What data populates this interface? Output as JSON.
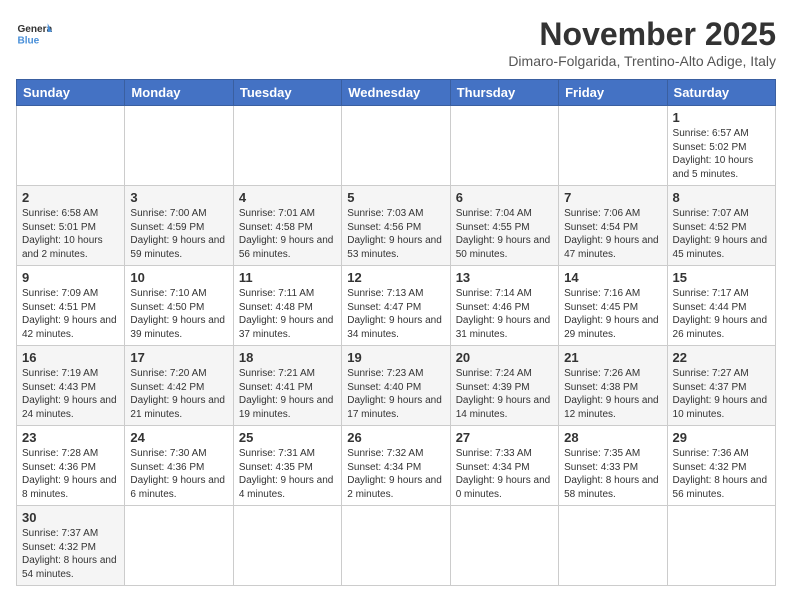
{
  "header": {
    "logo_general": "General",
    "logo_blue": "Blue",
    "month_title": "November 2025",
    "subtitle": "Dimaro-Folgarida, Trentino-Alto Adige, Italy"
  },
  "days_of_week": [
    "Sunday",
    "Monday",
    "Tuesday",
    "Wednesday",
    "Thursday",
    "Friday",
    "Saturday"
  ],
  "weeks": [
    [
      {
        "day": "",
        "info": ""
      },
      {
        "day": "",
        "info": ""
      },
      {
        "day": "",
        "info": ""
      },
      {
        "day": "",
        "info": ""
      },
      {
        "day": "",
        "info": ""
      },
      {
        "day": "",
        "info": ""
      },
      {
        "day": "1",
        "info": "Sunrise: 6:57 AM\nSunset: 5:02 PM\nDaylight: 10 hours and 5 minutes."
      }
    ],
    [
      {
        "day": "2",
        "info": "Sunrise: 6:58 AM\nSunset: 5:01 PM\nDaylight: 10 hours and 2 minutes."
      },
      {
        "day": "3",
        "info": "Sunrise: 7:00 AM\nSunset: 4:59 PM\nDaylight: 9 hours and 59 minutes."
      },
      {
        "day": "4",
        "info": "Sunrise: 7:01 AM\nSunset: 4:58 PM\nDaylight: 9 hours and 56 minutes."
      },
      {
        "day": "5",
        "info": "Sunrise: 7:03 AM\nSunset: 4:56 PM\nDaylight: 9 hours and 53 minutes."
      },
      {
        "day": "6",
        "info": "Sunrise: 7:04 AM\nSunset: 4:55 PM\nDaylight: 9 hours and 50 minutes."
      },
      {
        "day": "7",
        "info": "Sunrise: 7:06 AM\nSunset: 4:54 PM\nDaylight: 9 hours and 47 minutes."
      },
      {
        "day": "8",
        "info": "Sunrise: 7:07 AM\nSunset: 4:52 PM\nDaylight: 9 hours and 45 minutes."
      }
    ],
    [
      {
        "day": "9",
        "info": "Sunrise: 7:09 AM\nSunset: 4:51 PM\nDaylight: 9 hours and 42 minutes."
      },
      {
        "day": "10",
        "info": "Sunrise: 7:10 AM\nSunset: 4:50 PM\nDaylight: 9 hours and 39 minutes."
      },
      {
        "day": "11",
        "info": "Sunrise: 7:11 AM\nSunset: 4:48 PM\nDaylight: 9 hours and 37 minutes."
      },
      {
        "day": "12",
        "info": "Sunrise: 7:13 AM\nSunset: 4:47 PM\nDaylight: 9 hours and 34 minutes."
      },
      {
        "day": "13",
        "info": "Sunrise: 7:14 AM\nSunset: 4:46 PM\nDaylight: 9 hours and 31 minutes."
      },
      {
        "day": "14",
        "info": "Sunrise: 7:16 AM\nSunset: 4:45 PM\nDaylight: 9 hours and 29 minutes."
      },
      {
        "day": "15",
        "info": "Sunrise: 7:17 AM\nSunset: 4:44 PM\nDaylight: 9 hours and 26 minutes."
      }
    ],
    [
      {
        "day": "16",
        "info": "Sunrise: 7:19 AM\nSunset: 4:43 PM\nDaylight: 9 hours and 24 minutes."
      },
      {
        "day": "17",
        "info": "Sunrise: 7:20 AM\nSunset: 4:42 PM\nDaylight: 9 hours and 21 minutes."
      },
      {
        "day": "18",
        "info": "Sunrise: 7:21 AM\nSunset: 4:41 PM\nDaylight: 9 hours and 19 minutes."
      },
      {
        "day": "19",
        "info": "Sunrise: 7:23 AM\nSunset: 4:40 PM\nDaylight: 9 hours and 17 minutes."
      },
      {
        "day": "20",
        "info": "Sunrise: 7:24 AM\nSunset: 4:39 PM\nDaylight: 9 hours and 14 minutes."
      },
      {
        "day": "21",
        "info": "Sunrise: 7:26 AM\nSunset: 4:38 PM\nDaylight: 9 hours and 12 minutes."
      },
      {
        "day": "22",
        "info": "Sunrise: 7:27 AM\nSunset: 4:37 PM\nDaylight: 9 hours and 10 minutes."
      }
    ],
    [
      {
        "day": "23",
        "info": "Sunrise: 7:28 AM\nSunset: 4:36 PM\nDaylight: 9 hours and 8 minutes."
      },
      {
        "day": "24",
        "info": "Sunrise: 7:30 AM\nSunset: 4:36 PM\nDaylight: 9 hours and 6 minutes."
      },
      {
        "day": "25",
        "info": "Sunrise: 7:31 AM\nSunset: 4:35 PM\nDaylight: 9 hours and 4 minutes."
      },
      {
        "day": "26",
        "info": "Sunrise: 7:32 AM\nSunset: 4:34 PM\nDaylight: 9 hours and 2 minutes."
      },
      {
        "day": "27",
        "info": "Sunrise: 7:33 AM\nSunset: 4:34 PM\nDaylight: 9 hours and 0 minutes."
      },
      {
        "day": "28",
        "info": "Sunrise: 7:35 AM\nSunset: 4:33 PM\nDaylight: 8 hours and 58 minutes."
      },
      {
        "day": "29",
        "info": "Sunrise: 7:36 AM\nSunset: 4:32 PM\nDaylight: 8 hours and 56 minutes."
      }
    ],
    [
      {
        "day": "30",
        "info": "Sunrise: 7:37 AM\nSunset: 4:32 PM\nDaylight: 8 hours and 54 minutes."
      },
      {
        "day": "",
        "info": ""
      },
      {
        "day": "",
        "info": ""
      },
      {
        "day": "",
        "info": ""
      },
      {
        "day": "",
        "info": ""
      },
      {
        "day": "",
        "info": ""
      },
      {
        "day": "",
        "info": ""
      }
    ]
  ]
}
